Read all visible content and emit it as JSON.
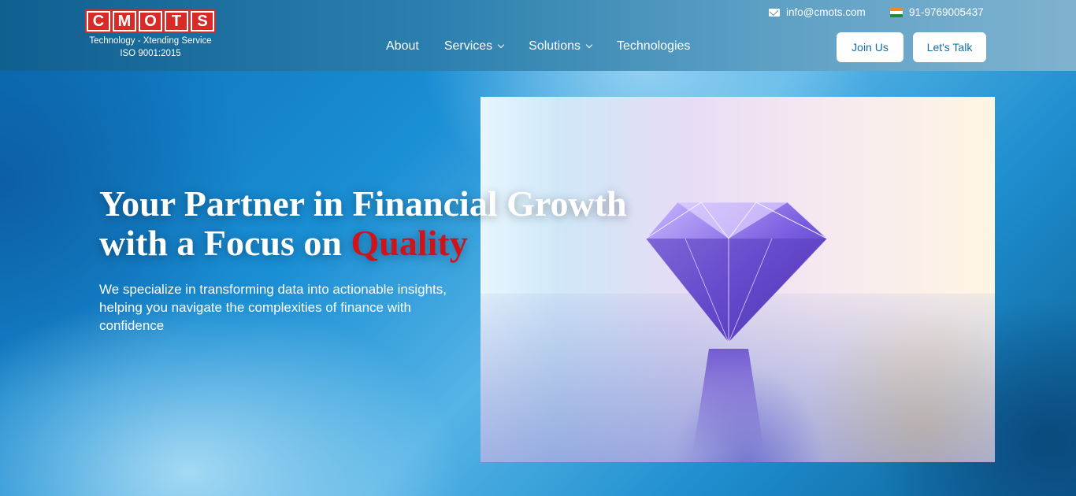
{
  "brand": {
    "logo_letters": [
      "C",
      "M",
      "O",
      "T",
      "S"
    ],
    "tagline": "Technology - Xtending Service",
    "iso": "ISO 9001:2015",
    "color": "#d92a27"
  },
  "contact": {
    "email": "info@cmots.com",
    "phone": "91-9769005437",
    "email_icon": "mail-icon",
    "phone_icon": "india-flag-icon"
  },
  "nav": {
    "items": [
      {
        "label": "About",
        "has_dropdown": false
      },
      {
        "label": "Services",
        "has_dropdown": true
      },
      {
        "label": "Solutions",
        "has_dropdown": true
      },
      {
        "label": "Technologies",
        "has_dropdown": false
      }
    ]
  },
  "buttons": {
    "join": "Join Us",
    "talk": "Let's Talk"
  },
  "hero": {
    "headline_line1": "Your Partner in Financial Growth",
    "headline_line2_prefix": "with a Focus on ",
    "headline_line2_accent": "Quality",
    "accent_color": "#d0121a",
    "subtext": "We specialize in transforming data into actionable insights, helping you navigate the complexities of finance with confidence",
    "image": "diamond-photo"
  }
}
